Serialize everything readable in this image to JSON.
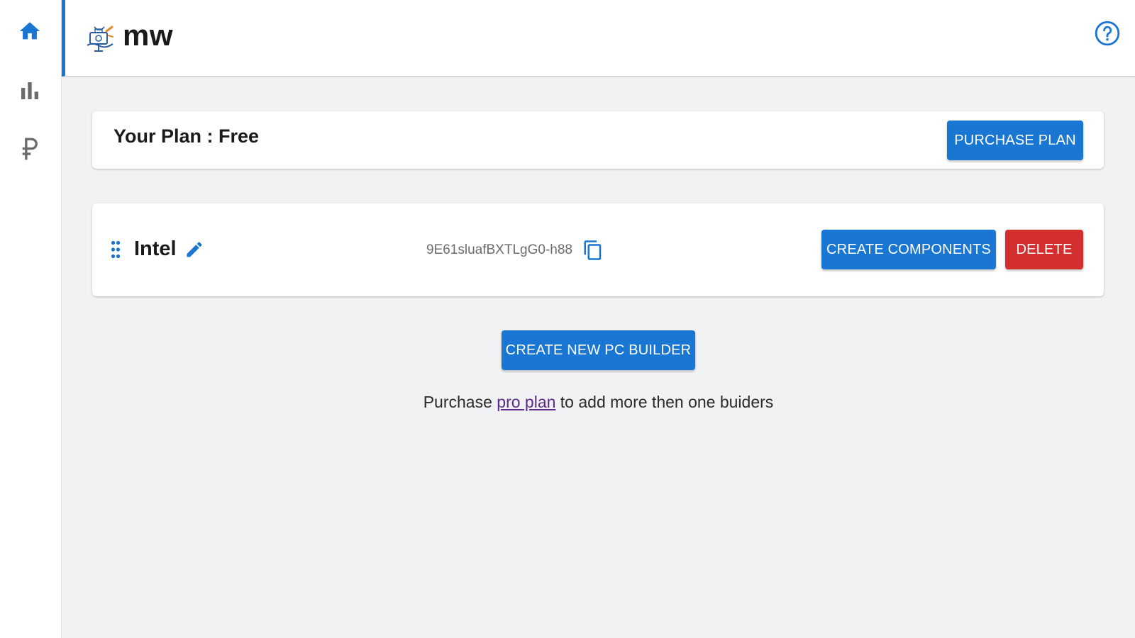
{
  "sidebar": {
    "items": [
      {
        "icon": "home-icon",
        "active": true,
        "color": "#1976d2"
      },
      {
        "icon": "bar-chart-icon",
        "active": false,
        "color": "#6b6b6b"
      },
      {
        "icon": "ruble-icon",
        "active": false,
        "color": "#6b6b6b"
      }
    ]
  },
  "header": {
    "title": "mw",
    "accent_color": "#1976d2",
    "help_icon": "help-circle-icon"
  },
  "plan": {
    "title": "Your Plan : Free",
    "purchase_label": "PURCHASE PLAN"
  },
  "builders": [
    {
      "name": "Intel",
      "id": "9E61sluafBXTLgG0-h88",
      "create_components_label": "CREATE COMPONENTS",
      "delete_label": "DELETE"
    }
  ],
  "actions": {
    "create_new_label": "CREATE NEW PC BUILDER"
  },
  "upsell": {
    "prefix": "Purchase ",
    "link": "pro plan",
    "suffix": " to add more then one buiders"
  },
  "colors": {
    "primary": "#1976d2",
    "danger": "#d32f2f",
    "background": "#f1f2f4"
  }
}
